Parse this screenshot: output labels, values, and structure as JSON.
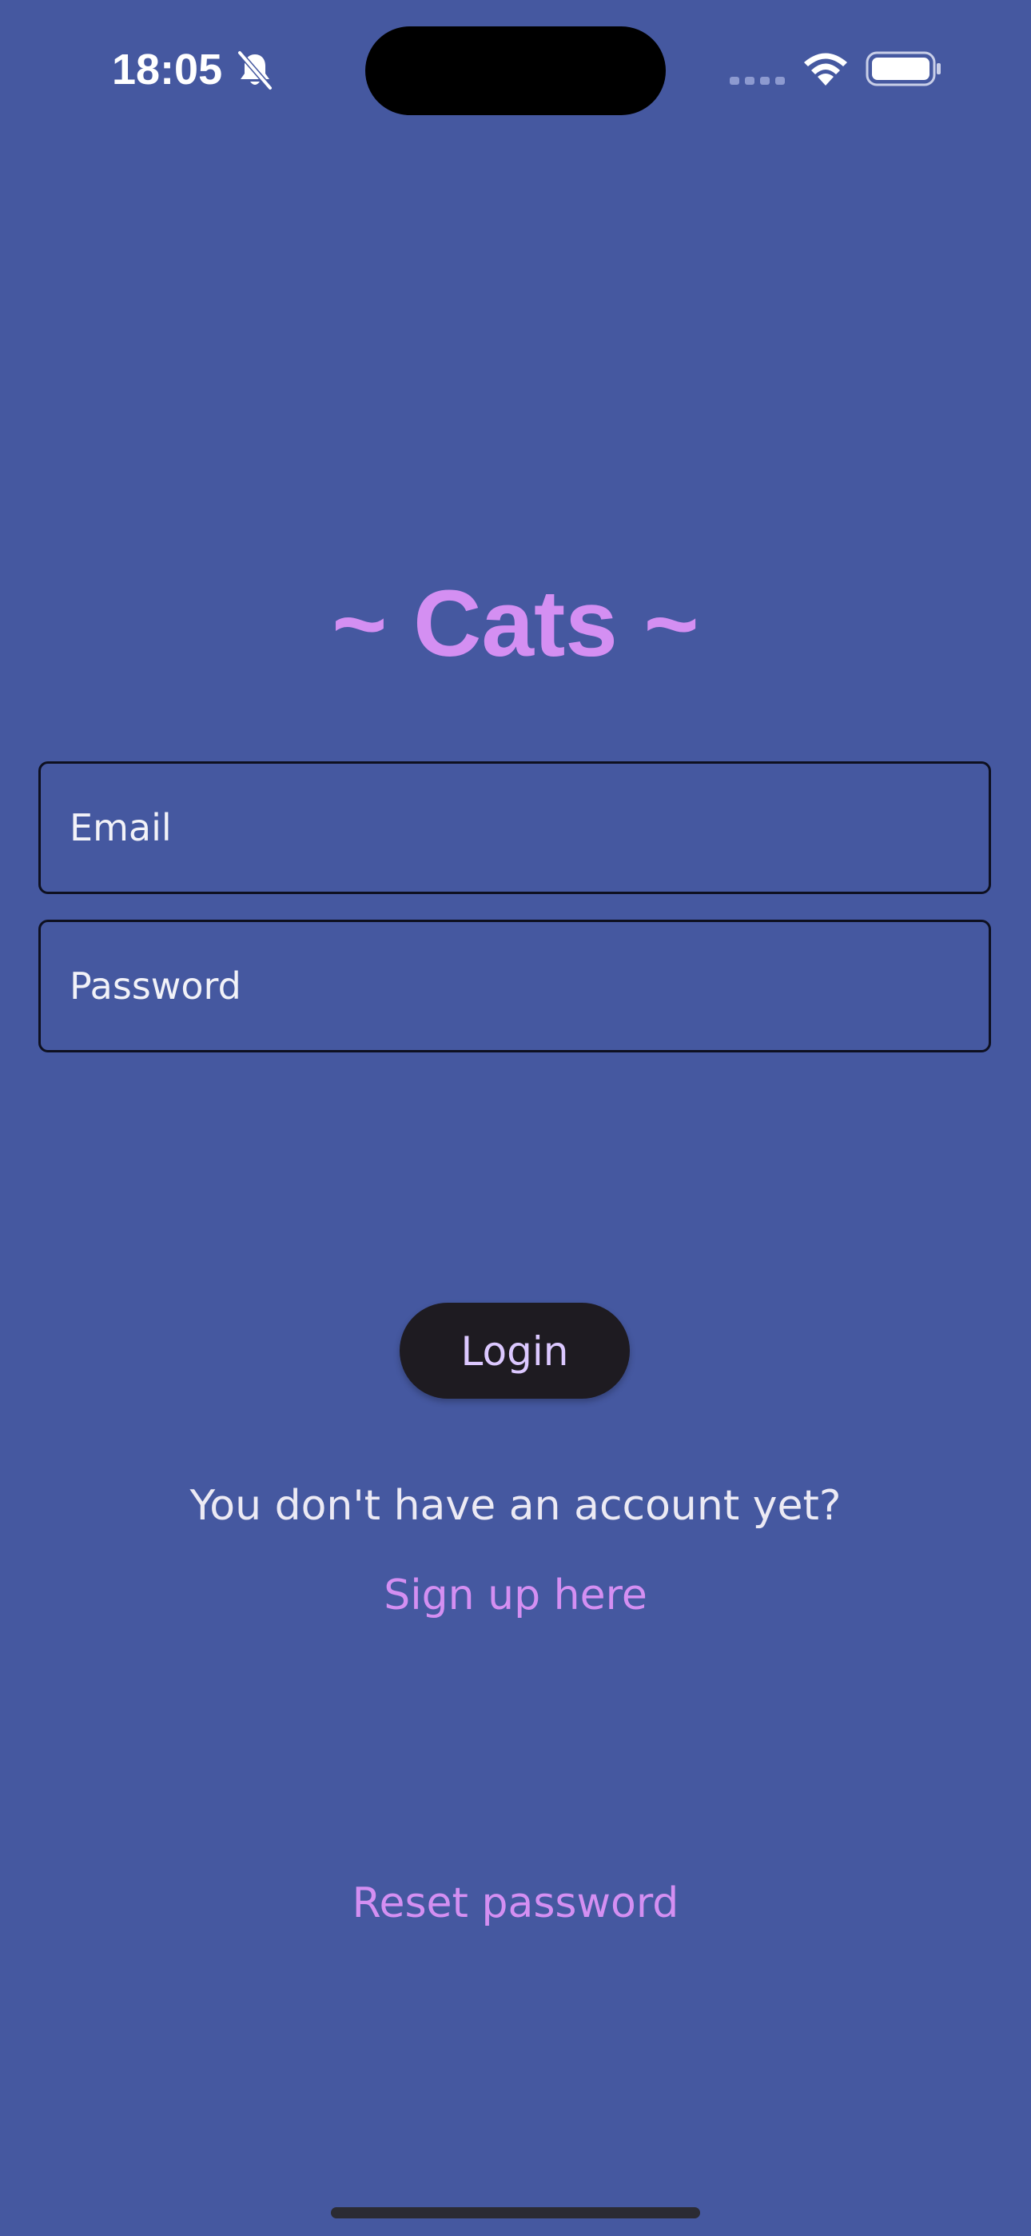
{
  "status_bar": {
    "time": "18:05",
    "icons": [
      "bell-slash-icon",
      "cellular-signal-icon",
      "wifi-icon",
      "battery-icon"
    ]
  },
  "app": {
    "title": "~ Cats ~"
  },
  "login_form": {
    "email_placeholder": "Email",
    "email_value": "",
    "password_placeholder": "Password",
    "password_value": "",
    "login_label": "Login"
  },
  "signup": {
    "prompt": "You don't have an account yet?",
    "link_label": "Sign up here"
  },
  "reset": {
    "link_label": "Reset password"
  },
  "colors": {
    "background": "#4558a0",
    "accent": "#d48ff2",
    "button_background": "#1e1b21",
    "button_text": "#dcc8ff"
  }
}
